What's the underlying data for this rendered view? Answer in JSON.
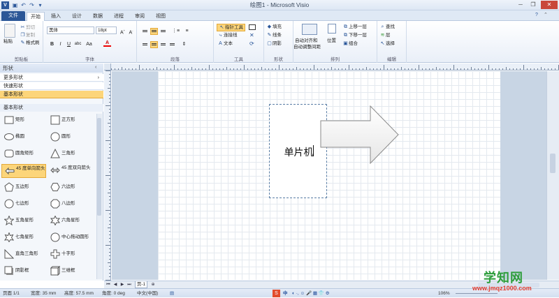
{
  "window": {
    "title": "绘图1 - Microsoft Visio"
  },
  "tabs": [
    {
      "label": "文件"
    },
    {
      "label": "开始"
    },
    {
      "label": "插入"
    },
    {
      "label": "设计"
    },
    {
      "label": "数据"
    },
    {
      "label": "进程"
    },
    {
      "label": "审阅"
    },
    {
      "label": "视图"
    }
  ],
  "ribbon": {
    "clipboard": {
      "label": "剪贴板",
      "paste": "粘贴",
      "cut": "剪切",
      "copy": "复制",
      "format_painter": "格式刷"
    },
    "font": {
      "label": "字体",
      "family": "黑体",
      "size": "18pt"
    },
    "paragraph": {
      "label": "段落"
    },
    "tools": {
      "label": "工具",
      "pointer": "指针工具",
      "connector": "连接线",
      "text": "文本"
    },
    "shape": {
      "label": "形状",
      "fill": "填充",
      "line": "线条",
      "shadow": "阴影"
    },
    "arrange": {
      "label": "排列",
      "auto_align": "自动对齐和",
      "auto_space": "自动调整间距",
      "position": "位置",
      "bring_forward": "上移一层",
      "send_backward": "下移一层",
      "group": "组合"
    },
    "editing": {
      "label": "编辑",
      "find": "查找",
      "layers": "层",
      "select": "选择"
    }
  },
  "pane": {
    "title": "形状",
    "more_shapes": "更多形状",
    "quick_shapes": "快速形状",
    "basic_stencil": "基本形状",
    "section_title": "基本形状",
    "shapes": [
      {
        "label": "矩形",
        "icon": "rectangle-icon"
      },
      {
        "label": "正方形",
        "icon": "square-icon"
      },
      {
        "label": "椭圆",
        "icon": "ellipse-icon"
      },
      {
        "label": "圆形",
        "icon": "circle-icon"
      },
      {
        "label": "圆角矩形",
        "icon": "rounded-rectangle-icon"
      },
      {
        "label": "三角形",
        "icon": "triangle-icon"
      },
      {
        "label": "45 度单向箭头",
        "icon": "single-arrow-icon"
      },
      {
        "label": "45 度双向箭头",
        "icon": "double-arrow-icon"
      },
      {
        "label": "五边形",
        "icon": "pentagon-icon"
      },
      {
        "label": "六边形",
        "icon": "hexagon-icon"
      },
      {
        "label": "七边形",
        "icon": "heptagon-icon"
      },
      {
        "label": "八边形",
        "icon": "octagon-icon"
      },
      {
        "label": "五角星形",
        "icon": "five-star-icon"
      },
      {
        "label": "六角星形",
        "icon": "six-star-icon"
      },
      {
        "label": "七角星形",
        "icon": "seven-star-icon"
      },
      {
        "label": "中心拖动圆形",
        "icon": "center-drag-circle-icon"
      },
      {
        "label": "直角三角形",
        "icon": "right-triangle-icon"
      },
      {
        "label": "十字形",
        "icon": "cross-icon"
      },
      {
        "label": "阴影框",
        "icon": "shadow-box-icon"
      },
      {
        "label": "三维框",
        "icon": "3d-box-icon"
      }
    ]
  },
  "canvas": {
    "rect_text": "单片机"
  },
  "pagebar": {
    "page_tab": "页-1"
  },
  "status": {
    "page": "页面 1/1",
    "width": "宽度: 35 mm",
    "height": "高度: 57.5 mm",
    "angle": "角度: 0 deg",
    "language": "中文(中国)",
    "zoom": "106%"
  },
  "watermark": {
    "title": "学知网",
    "url": "www.jmqz1000.com"
  },
  "colors": {
    "accent": "#2b5797",
    "highlight": "#fcd57a",
    "watermark": "#2e9e3c"
  }
}
